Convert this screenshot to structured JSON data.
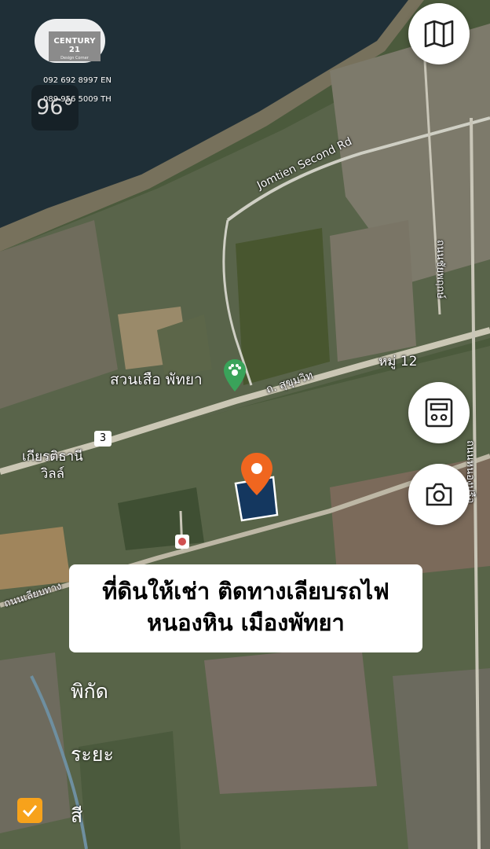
{
  "logo": {
    "brand": "CENTURY 21",
    "sub": "Design Corner"
  },
  "contacts": {
    "phone_en": "092 692 8997 EN",
    "phone_th": "089 956 5009 TH"
  },
  "weather": {
    "temperature": "96°"
  },
  "map_labels": {
    "road_jomtien": "Jomtien Second Rd",
    "road_sukhumvit": "ถ. สุขุมวิท",
    "road_railway": "ถนนเลียบทาง",
    "road_right": "ถนนชัยพฤกษ์",
    "road_right2": "ถนนหนองปรือ",
    "village": "หมู่ 12",
    "tiger_park": "สวนเสือ พัทยา",
    "route_number": "3",
    "kiat_line1": "เกียรติธานี",
    "kiat_line2": "วิลล์"
  },
  "caption": {
    "line1": "ที่ดินให้เช่า ติดทางเลียบรถไฟ",
    "line2": "หนองหิน เมืองพัทยา"
  },
  "details": {
    "coordinates_label": "พิกัด",
    "distance_label": "ระยะ",
    "color_label": "สี"
  },
  "icons": {
    "map": "map-icon",
    "calculator": "calculator-icon",
    "camera": "camera-icon",
    "pin": "location-pin-icon",
    "paw": "paw-icon",
    "check": "check-icon"
  },
  "colors": {
    "pin": "#f0661f",
    "plot": "#14375f",
    "paw_badge": "#3aa35a",
    "check": "#f7a21b"
  }
}
